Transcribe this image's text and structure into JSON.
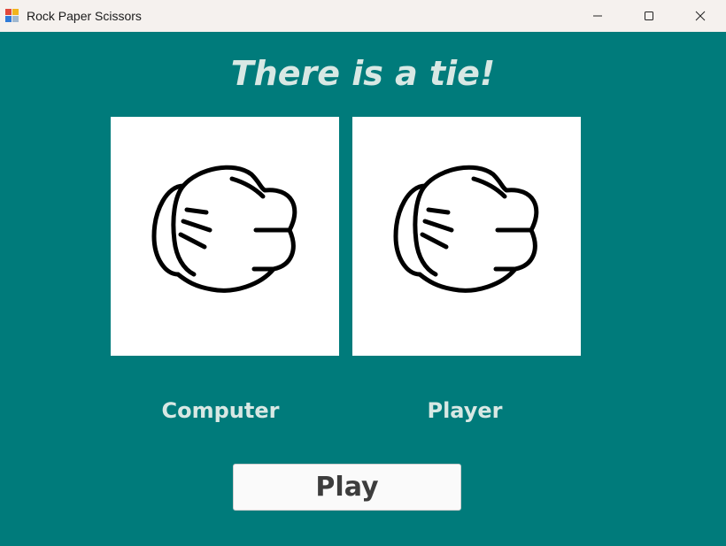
{
  "window": {
    "title": "Rock Paper Scissors",
    "controls": [
      "minimize-icon",
      "maximize-icon",
      "close-icon"
    ]
  },
  "game": {
    "result": "There is a tie!",
    "computer": {
      "label": "Computer",
      "choice_icon": "rock-fist-icon"
    },
    "player": {
      "label": "Player",
      "choice_icon": "rock-fist-icon"
    },
    "play_label": "Play"
  },
  "colors": {
    "background": "#007b7b",
    "text": "#d8e8e4",
    "button_text": "#3d3d3d"
  }
}
